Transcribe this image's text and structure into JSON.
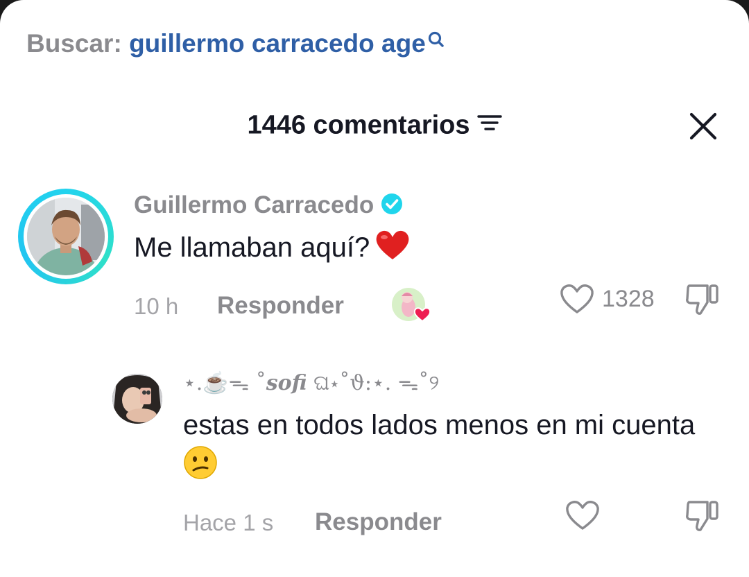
{
  "search": {
    "label": "Buscar:",
    "query": "guillermo carracedo age",
    "icon": "search-icon"
  },
  "header": {
    "count_title": "1446 comentarios",
    "filter_icon": "filter-icon",
    "close_icon": "close-icon"
  },
  "colors": {
    "query": "#2f5fa6",
    "text": "#161823",
    "muted": "#8a8a8e",
    "verified": "#20d5ec",
    "heart": "#ee1d52"
  },
  "comments": [
    {
      "author": "Guillermo Carracedo",
      "verified": true,
      "text": "Me llamaban aquí?",
      "emoji": "heart-emoji",
      "time": "10 h",
      "reply_label": "Responder",
      "likes": "1328",
      "creator_liked": true,
      "replies": [
        {
          "author_prefix": "⋆.☕️ᯓ ˚",
          "author_name": "sofi",
          "author_suffix": " ଘ⋆˚ϑ:⋆. ᯓ˚୨",
          "text": "estas en todos lados menos en mi cuenta",
          "emoji": "confused-face-emoji",
          "time": "Hace 1 s",
          "reply_label": "Responder"
        }
      ]
    }
  ]
}
